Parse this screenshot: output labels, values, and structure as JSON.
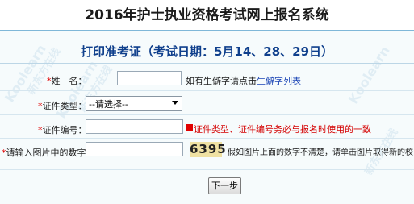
{
  "header": {
    "title": "2016年护士执业资格考试网上报名系统"
  },
  "section": {
    "subtitle": "打印准考证（考试日期：5月14、28、29日）"
  },
  "form": {
    "name": {
      "label": "姓　名：",
      "value": "",
      "hint_prefix": "如有生僻字请点击",
      "hint_link": "生僻字列表"
    },
    "id_type": {
      "label": "证件类型：",
      "selected": "--请选择--"
    },
    "id_number": {
      "label": "证件编号：",
      "value": "",
      "error": "证件类型、证件编号务必与报名时使用的一致"
    },
    "captcha": {
      "label": "请输入图片中的数字：",
      "value": "",
      "image_text": "6395",
      "hint": "假如图片上面的数字不清楚，请单击图片取得新的校验码"
    },
    "required_mark": "*"
  },
  "actions": {
    "next_label": "下一步"
  },
  "watermark": {
    "text": "Koolearn",
    "subtext": "新东方在线"
  },
  "colors": {
    "subtitle": "#0f3f8c",
    "required": "#e00000",
    "error": "#d40000",
    "link": "#1a44b5",
    "captcha_bg": "#efe1a2"
  }
}
